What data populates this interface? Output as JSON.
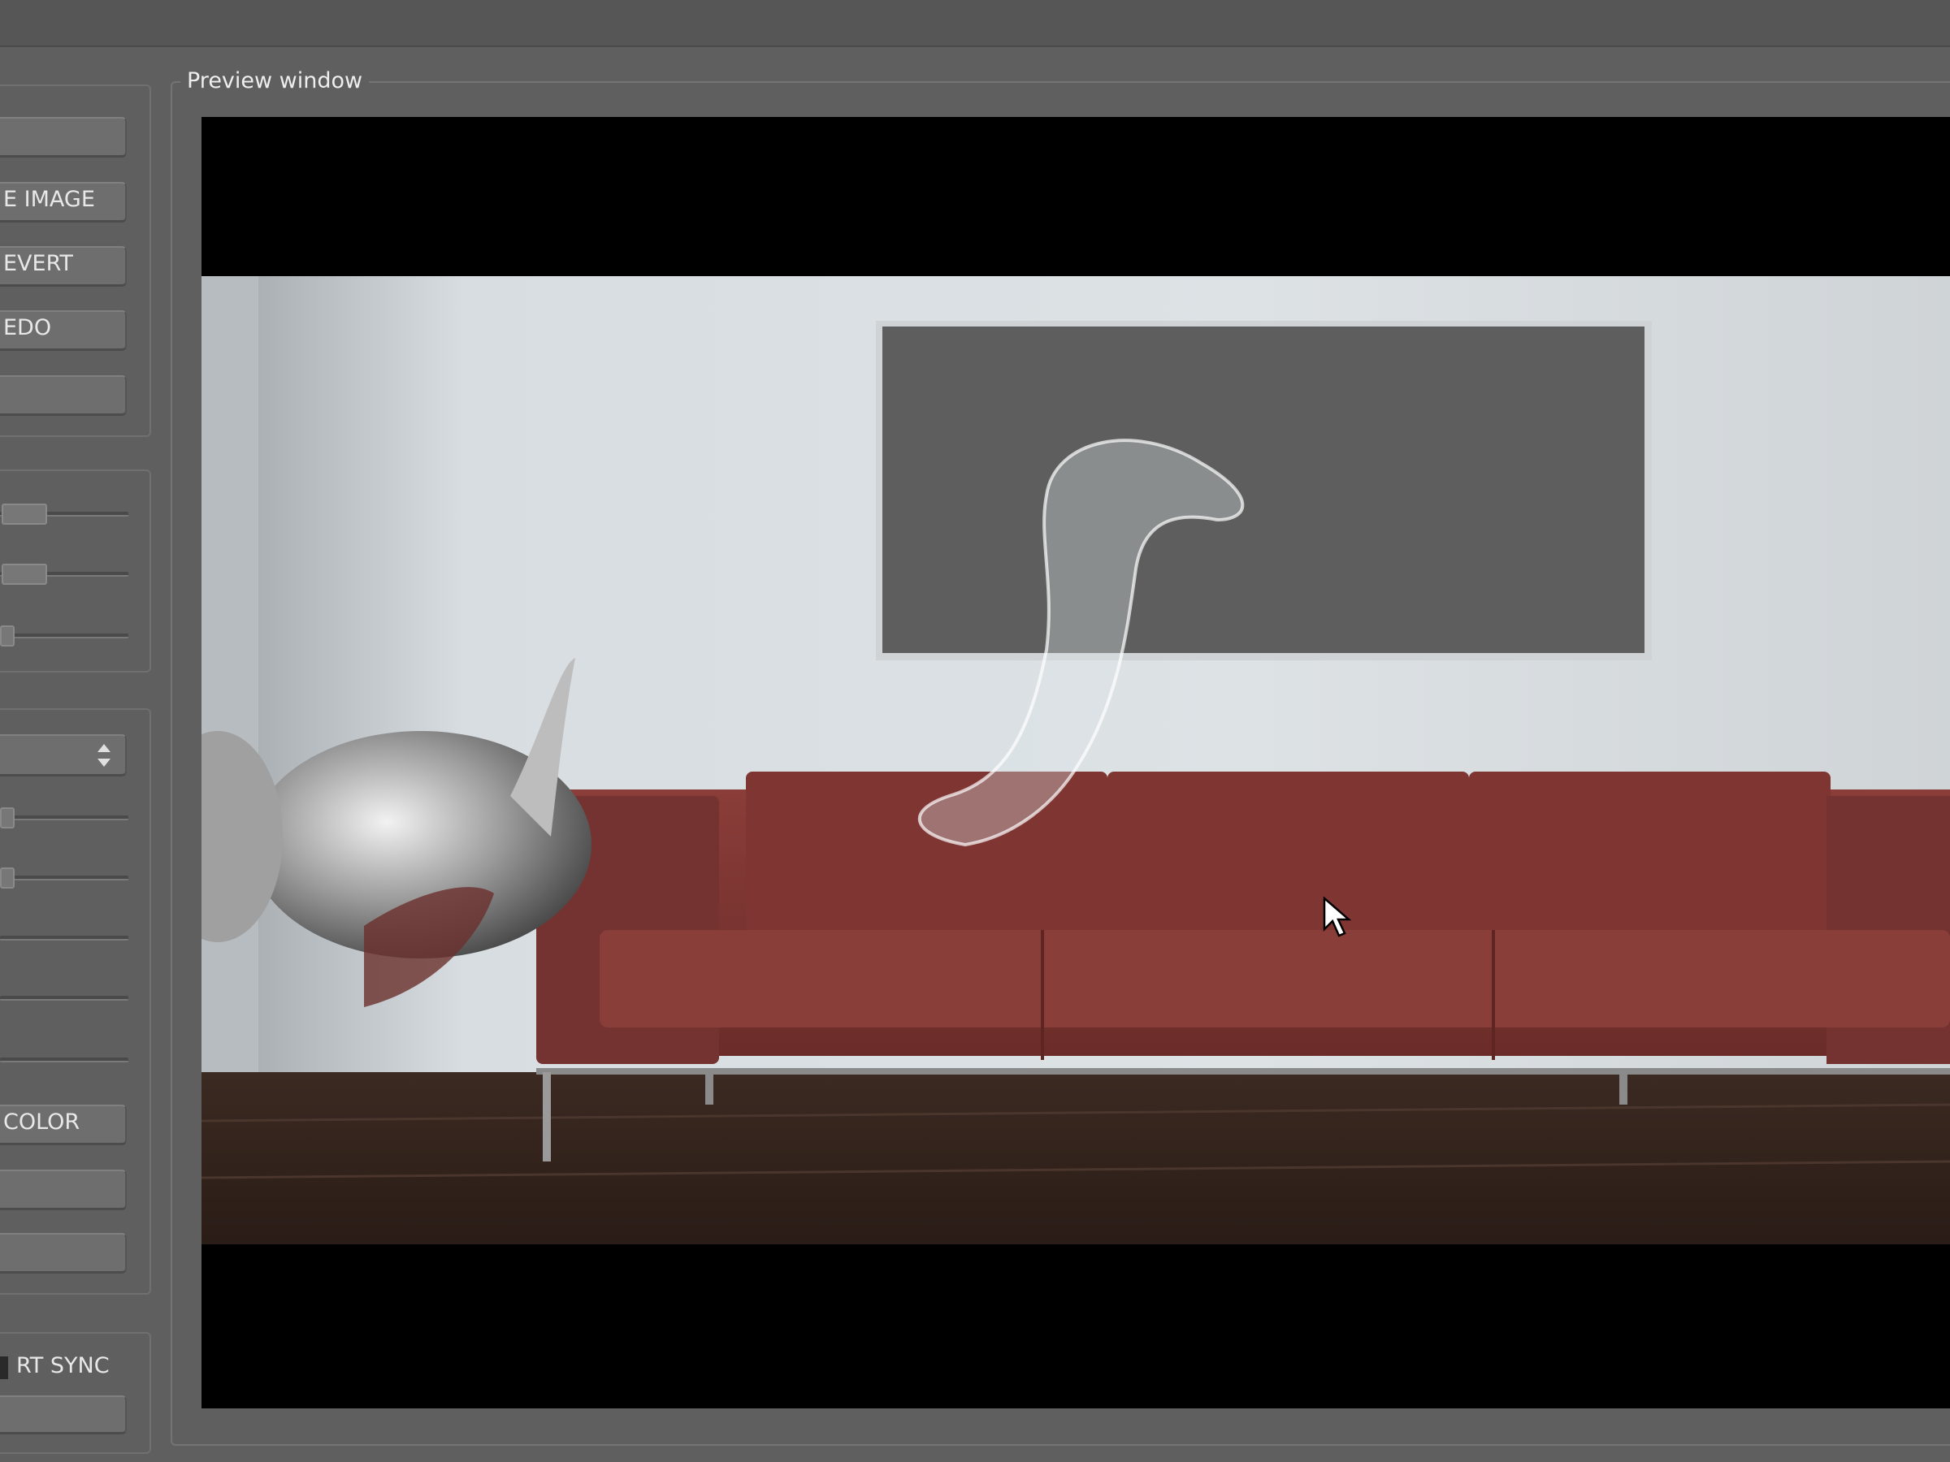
{
  "toolbar_buttons": [
    "",
    "E IMAGE",
    "EVERT",
    "EDO",
    ""
  ],
  "sliders_group1": [
    "",
    "",
    ""
  ],
  "bottom_buttons": [
    "COLOR",
    "",
    ""
  ],
  "checkbox_label": "RT SYNC",
  "preview": {
    "title": "Preview window"
  },
  "colors": {
    "panel": "#5f5f5f",
    "sofa": "#7d3532",
    "frame": "#5e5e5e"
  }
}
